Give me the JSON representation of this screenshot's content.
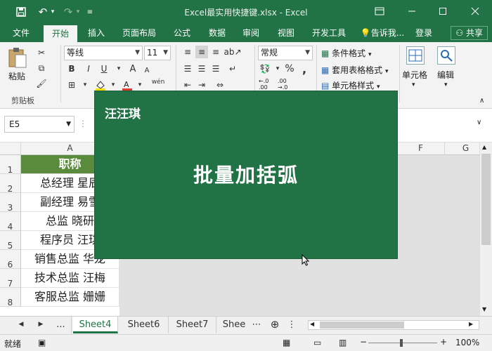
{
  "window": {
    "title": "Excel最实用快捷键.xlsx - Excel",
    "icons": [
      "save-icon",
      "undo-icon",
      "redo-icon",
      "customize-qat-icon",
      "ribbon-options-icon",
      "minimize-icon",
      "restore-icon",
      "close-icon"
    ]
  },
  "ribbon_tabs": [
    "文件",
    "开始",
    "插入",
    "页面布局",
    "公式",
    "数据",
    "审阅",
    "视图",
    "开发工具"
  ],
  "active_tab": "开始",
  "tell_me": "告诉我...",
  "login": "登录",
  "share": "共享",
  "ribbon": {
    "paste_label": "粘贴",
    "clipboard_label": "剪贴板",
    "font_name": "等线",
    "font_size": "11",
    "bold": "B",
    "italic": "I",
    "underline": "U",
    "font_grow": "A",
    "font_shrink": "A",
    "phonetic": "wén",
    "number_format": "常规",
    "percent": "%",
    "comma": ",",
    "dec_inc": "←.0 .00",
    "dec_dec": ".00 →.0",
    "conditional_format": "条件格式",
    "table_format": "套用表格格式",
    "cell_style": "单元格样式",
    "cells_label": "单元格",
    "edit_label": "编辑"
  },
  "formula_bar": {
    "name_box": "E5"
  },
  "columns": [
    "A",
    "F",
    "G"
  ],
  "rows": [
    "1",
    "2",
    "3",
    "4",
    "5",
    "6",
    "7",
    "8"
  ],
  "cells": [
    "职称",
    "总经理 星辰",
    "副经理 易雪",
    "总监 晓研",
    "程序员 汪琪",
    "销售总监 华龙",
    "技术总监 汪梅",
    "客服总监 姗姗"
  ],
  "sheets": [
    "Sheet4",
    "Sheet6",
    "Sheet7",
    "Shee"
  ],
  "sheet_nav": [
    "◀",
    "▶",
    "..."
  ],
  "active_sheet": "Sheet4",
  "status": {
    "ready": "就绪",
    "zoom": "100%"
  },
  "overlay": {
    "brand": "汪汪琪",
    "title": "批量加括弧"
  },
  "colors": {
    "excel_green": "#217346",
    "header_fill": "#5a8a3c"
  }
}
